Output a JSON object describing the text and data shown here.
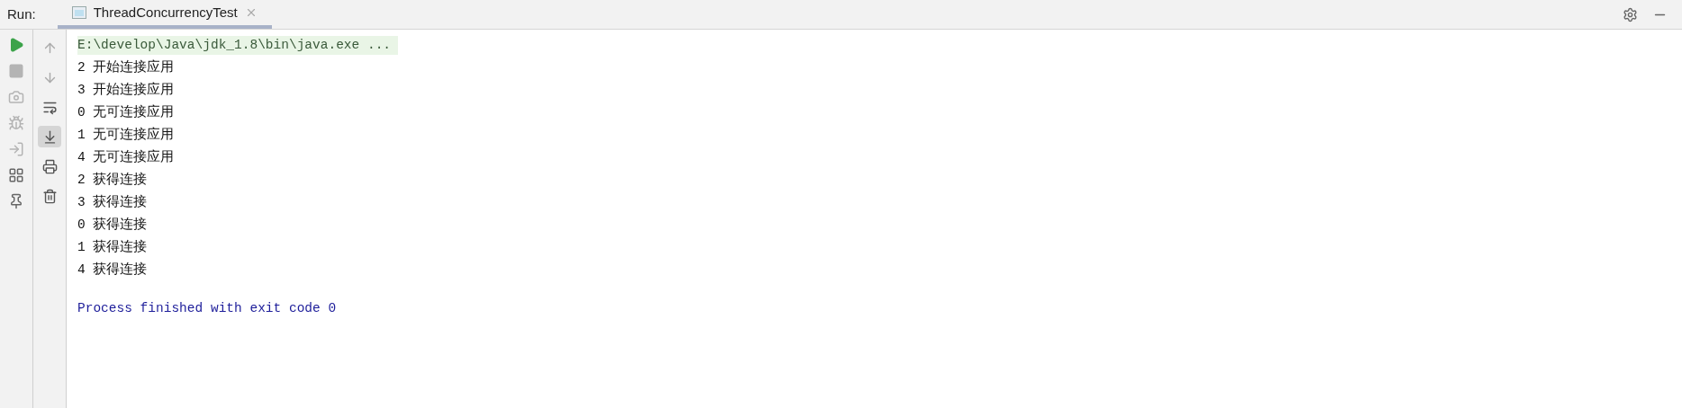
{
  "header": {
    "label": "Run:",
    "tab": {
      "title": "ThreadConcurrencyTest",
      "selected": true
    }
  },
  "left_toolbar": [
    {
      "kind": "run",
      "disabled": false
    },
    {
      "kind": "stop",
      "disabled": true
    },
    {
      "kind": "camera",
      "disabled": true
    },
    {
      "kind": "bug",
      "disabled": true
    },
    {
      "kind": "login",
      "disabled": true
    },
    {
      "kind": "layout",
      "disabled": false
    },
    {
      "kind": "pin",
      "disabled": false
    }
  ],
  "console_toolbar": [
    {
      "kind": "up",
      "selected": false
    },
    {
      "kind": "down",
      "selected": false
    },
    {
      "kind": "wrap",
      "selected": false
    },
    {
      "kind": "scroll-end",
      "selected": true
    },
    {
      "kind": "print",
      "selected": false
    },
    {
      "kind": "trash",
      "selected": false
    }
  ],
  "console": [
    {
      "kind": "command",
      "text": "E:\\develop\\Java\\jdk_1.8\\bin\\java.exe ..."
    },
    {
      "kind": "output",
      "text": "2 开始连接应用"
    },
    {
      "kind": "output",
      "text": "3 开始连接应用"
    },
    {
      "kind": "output",
      "text": "0 无可连接应用"
    },
    {
      "kind": "output",
      "text": "1 无可连接应用"
    },
    {
      "kind": "output",
      "text": "4 无可连接应用"
    },
    {
      "kind": "output",
      "text": "2 获得连接"
    },
    {
      "kind": "output",
      "text": "3 获得连接"
    },
    {
      "kind": "output",
      "text": "0 获得连接"
    },
    {
      "kind": "output",
      "text": "1 获得连接"
    },
    {
      "kind": "output",
      "text": "4 获得连接"
    },
    {
      "kind": "blank"
    },
    {
      "kind": "exit",
      "text": "Process finished with exit code 0"
    }
  ]
}
